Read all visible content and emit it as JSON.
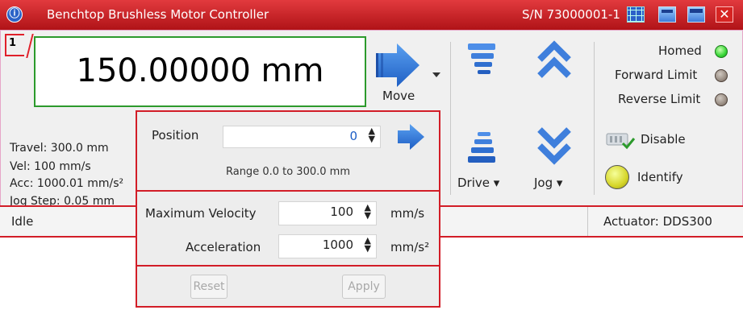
{
  "window": {
    "title": "Benchtop Brushless Motor Controller",
    "serial": "S/N 73000001-1",
    "info_icon": "ⓘ",
    "close_glyph": "✕"
  },
  "channel": {
    "number": "1"
  },
  "position_display": "150.00000 mm",
  "move": {
    "label": "Move"
  },
  "drive": {
    "label": "Drive ▾"
  },
  "jog": {
    "label": "Jog ▾"
  },
  "settings": {
    "travel": "Travel: 300.0 mm",
    "vel": "Vel: 100 mm/s",
    "acc": "Acc: 1000.01 mm/s²",
    "jog_step": "Jog Step: 0.05 mm"
  },
  "indicators": {
    "homed": "Homed",
    "forward_limit": "Forward Limit",
    "reverse_limit": "Reverse Limit",
    "homed_color": "#36d636",
    "limit_color": "#9a8e84"
  },
  "controls": {
    "disable": "Disable",
    "identify": "Identify"
  },
  "status": {
    "state": "Idle",
    "actuator": "Actuator:  DDS300"
  },
  "popup": {
    "position_label": "Position",
    "position_value": "0",
    "range_text": "Range 0.0 to 300.0 mm",
    "max_velocity_label": "Maximum Velocity",
    "max_velocity_value": "100",
    "max_velocity_unit": "mm/s",
    "acceleration_label": "Acceleration",
    "acceleration_value": "1000",
    "acceleration_unit": "mm/s²",
    "reset_label": "Reset",
    "apply_label": "Apply"
  },
  "colors": {
    "titlebar": "#c41e22",
    "accent_blue": "#2f78d8",
    "highlight_red": "#d21d27",
    "position_border": "#2c9a2c"
  }
}
